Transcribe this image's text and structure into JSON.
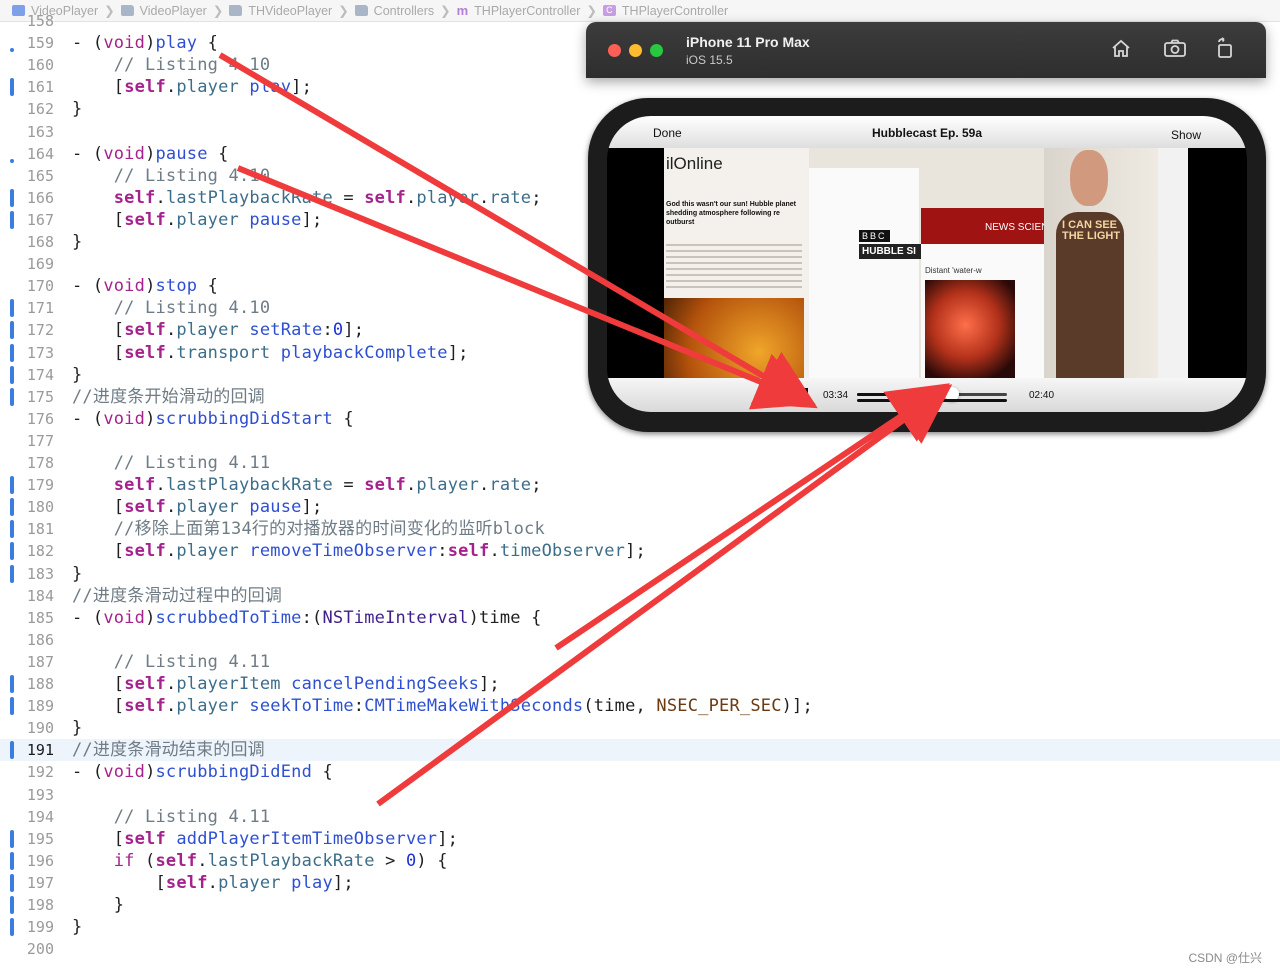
{
  "breadcrumb": [
    {
      "label": "VideoPlayer",
      "icon": "app-icon"
    },
    {
      "label": "VideoPlayer",
      "icon": "folder-icon"
    },
    {
      "label": "THVideoPlayer",
      "icon": "folder-icon"
    },
    {
      "label": "Controllers",
      "icon": "folder-icon"
    },
    {
      "label": "THPlayerController",
      "icon": "objc-file-icon"
    },
    {
      "label": "THPlayerController",
      "icon": "class-icon"
    }
  ],
  "editor": {
    "current_line": "191",
    "lines": [
      {
        "n": "158",
        "text": ""
      },
      {
        "n": "159",
        "text": "- (void)play {"
      },
      {
        "n": "160",
        "text": "    // Listing 4.10"
      },
      {
        "n": "161",
        "text": "    [self.player play];"
      },
      {
        "n": "162",
        "text": "}"
      },
      {
        "n": "163",
        "text": ""
      },
      {
        "n": "164",
        "text": "- (void)pause {"
      },
      {
        "n": "165",
        "text": "    // Listing 4.10"
      },
      {
        "n": "166",
        "text": "    self.lastPlaybackRate = self.player.rate;"
      },
      {
        "n": "167",
        "text": "    [self.player pause];"
      },
      {
        "n": "168",
        "text": "}"
      },
      {
        "n": "169",
        "text": ""
      },
      {
        "n": "170",
        "text": "- (void)stop {"
      },
      {
        "n": "171",
        "text": "    // Listing 4.10"
      },
      {
        "n": "172",
        "text": "    [self.player setRate:0];"
      },
      {
        "n": "173",
        "text": "    [self.transport playbackComplete];"
      },
      {
        "n": "174",
        "text": "}"
      },
      {
        "n": "175",
        "text": "//进度条开始滑动的回调"
      },
      {
        "n": "176",
        "text": "- (void)scrubbingDidStart {"
      },
      {
        "n": "177",
        "text": ""
      },
      {
        "n": "178",
        "text": "    // Listing 4.11"
      },
      {
        "n": "179",
        "text": "    self.lastPlaybackRate = self.player.rate;"
      },
      {
        "n": "180",
        "text": "    [self.player pause];"
      },
      {
        "n": "181",
        "text": "    //移除上面第134行的对播放器的时间变化的监听block"
      },
      {
        "n": "182",
        "text": "    [self.player removeTimeObserver:self.timeObserver];"
      },
      {
        "n": "183",
        "text": "}"
      },
      {
        "n": "184",
        "text": "//进度条滑动过程中的回调"
      },
      {
        "n": "185",
        "text": "- (void)scrubbedToTime:(NSTimeInterval)time {"
      },
      {
        "n": "186",
        "text": ""
      },
      {
        "n": "187",
        "text": "    // Listing 4.11"
      },
      {
        "n": "188",
        "text": "    [self.playerItem cancelPendingSeeks];"
      },
      {
        "n": "189",
        "text": "    [self.player seekToTime:CMTimeMakeWithSeconds(time, NSEC_PER_SEC)];"
      },
      {
        "n": "190",
        "text": "}"
      },
      {
        "n": "191",
        "text": "//进度条滑动结束的回调"
      },
      {
        "n": "192",
        "text": "- (void)scrubbingDidEnd {"
      },
      {
        "n": "193",
        "text": ""
      },
      {
        "n": "194",
        "text": "    // Listing 4.11"
      },
      {
        "n": "195",
        "text": "    [self addPlayerItemTimeObserver];"
      },
      {
        "n": "196",
        "text": "    if (self.lastPlaybackRate > 0) {"
      },
      {
        "n": "197",
        "text": "        [self.player play];"
      },
      {
        "n": "198",
        "text": "    }"
      },
      {
        "n": "199",
        "text": "}"
      },
      {
        "n": "200",
        "text": ""
      }
    ]
  },
  "simulator": {
    "device": "iPhone 11 Pro Max",
    "os": "iOS 15.5",
    "toolbar_icons": [
      "home-icon",
      "screenshot-icon",
      "rotate-icon"
    ]
  },
  "player": {
    "done_label": "Done",
    "title": "Hubblecast Ep. 59a",
    "show_label": "Show",
    "current_time": "03:34",
    "remaining_time": "02:40",
    "progress": 0.63
  },
  "video_frame": {
    "site_brand": "ilOnline",
    "headline": "God this wasn't our sun! Hubble planet shedding atmosphere following re outburst",
    "bbc_label": "BBC",
    "hubble_label": "HUBBLE SI",
    "news_label": "NEWS SCIENC",
    "caption": "Distant 'water-w",
    "shirt_text": "I CAN SEE THE LIGHT"
  },
  "colors": {
    "keyword": "#a5228d",
    "function": "#2e4fd1",
    "comment": "#6f7c86",
    "change_bar": "#3b7dde",
    "arrow": "#ef3b3b",
    "current_line_bg": "#edf4fc"
  },
  "watermark": "CSDN @仕兴"
}
